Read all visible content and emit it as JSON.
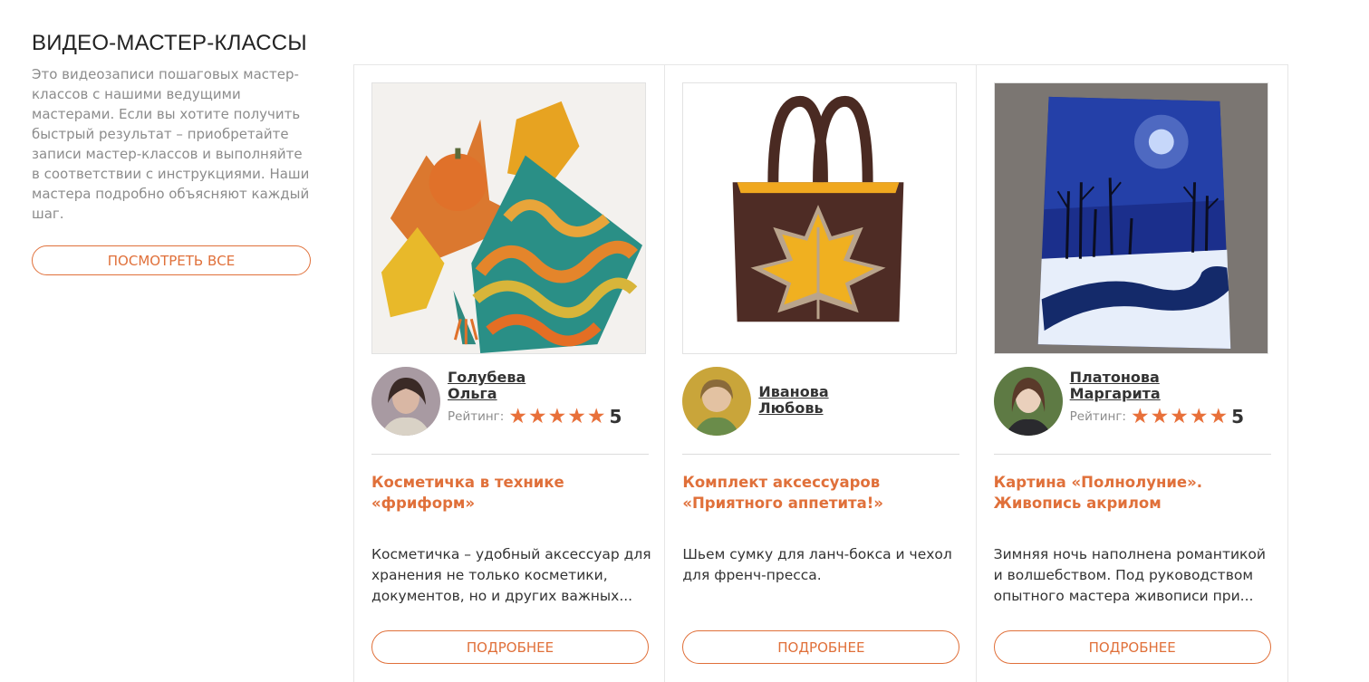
{
  "section": {
    "title": "ВИДЕО-МАСТЕР-КЛАССЫ",
    "description": "Это видеозаписи пошаговых мастер-классов с нашими ведущими мастерами. Если вы хотите получить быстрый результат – приобретайте записи мастер-классов и выполняйте в соответствии с инструкциями. Наши мастера подробно объясняют каждый шаг.",
    "view_all_label": "ПОСМОТРЕТЬ ВСЕ"
  },
  "rating_label": "Рейтинг:",
  "more_label": "ПОДРОБНЕЕ",
  "colors": {
    "accent": "#e0703a",
    "star": "#e8703a",
    "text": "#333333",
    "muted": "#8c8c8c",
    "border": "#e6e6e6"
  },
  "cards": [
    {
      "image": "crochet-cosmetic-bag-photo",
      "author": {
        "first_line": "Голубева",
        "second_line": "Ольга",
        "rating_stars": 5,
        "rating_value": "5"
      },
      "title": "Косметичка в технике «фриформ»",
      "description": "Косметичка – удобный аксессуар для хранения не только косметики, документов, но и других важных..."
    },
    {
      "image": "tote-bag-maple-leaf-photo",
      "author": {
        "first_line": "Иванова",
        "second_line": "Любовь",
        "rating_stars": 0,
        "rating_value": ""
      },
      "title": "Комплект аксессуаров «Приятного аппетита!»",
      "description": "Шьем сумку для ланч-бокса и чехол для френч-пресса."
    },
    {
      "image": "full-moon-acrylic-painting-photo",
      "author": {
        "first_line": "Платонова",
        "second_line": "Маргарита",
        "rating_stars": 5,
        "rating_value": "5"
      },
      "title": "Картина «Полнолуние». Живопись акрилом",
      "description": "Зимняя ночь наполнена романтикой и волшебством. Под руководством опытного мастера живописи при..."
    }
  ]
}
